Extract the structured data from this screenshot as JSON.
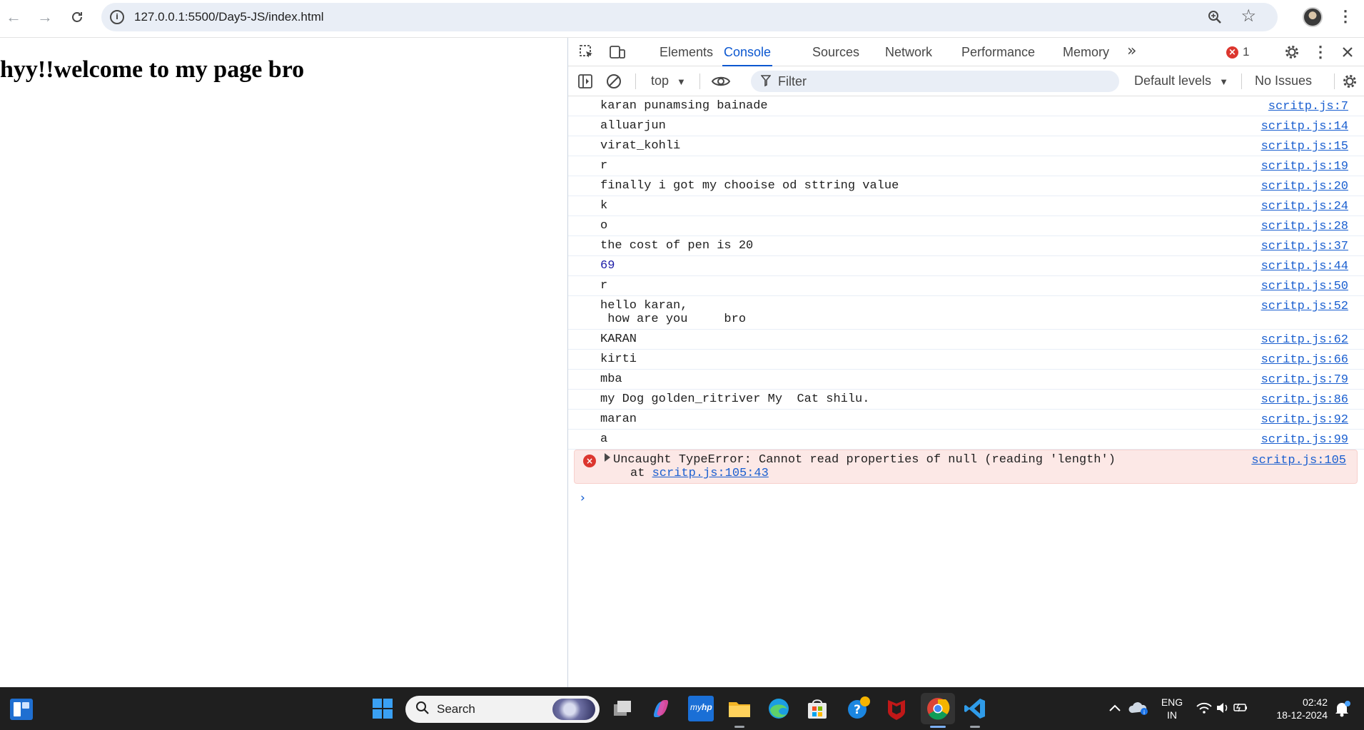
{
  "browser": {
    "url": "127.0.0.1:5500/Day5-JS/index.html"
  },
  "page": {
    "heading": "hyy!!welcome to my page bro"
  },
  "devtools": {
    "tabs": [
      "Elements",
      "Console",
      "Sources",
      "Network",
      "Performance",
      "Memory"
    ],
    "active_tab": "Console",
    "error_count": "1",
    "context": "top",
    "filter_placeholder": "Filter",
    "levels": "Default levels",
    "issues": "No Issues",
    "messages": [
      {
        "text": "karan punamsing bainade",
        "source": "scritp.js:7"
      },
      {
        "text": "alluarjun",
        "source": "scritp.js:14"
      },
      {
        "text": "virat_kohli",
        "source": "scritp.js:15"
      },
      {
        "text": "r",
        "source": "scritp.js:19"
      },
      {
        "text": "finally i got my chooise od sttring value",
        "source": "scritp.js:20"
      },
      {
        "text": "k",
        "source": "scritp.js:24"
      },
      {
        "text": "o",
        "source": "scritp.js:28"
      },
      {
        "text": "the cost of pen is 20",
        "source": "scritp.js:37"
      },
      {
        "text": "69",
        "source": "scritp.js:44",
        "type": "number"
      },
      {
        "text": "r",
        "source": "scritp.js:50"
      },
      {
        "text": "hello karan,\n how are you     bro",
        "source": "scritp.js:52"
      },
      {
        "text": "KARAN",
        "source": "scritp.js:62"
      },
      {
        "text": "kirti",
        "source": "scritp.js:66"
      },
      {
        "text": "mba",
        "source": "scritp.js:79"
      },
      {
        "text": "my Dog golden_ritriver My  Cat shilu.",
        "source": "scritp.js:86"
      },
      {
        "text": "maran",
        "source": "scritp.js:92"
      },
      {
        "text": "a",
        "source": "scritp.js:99"
      }
    ],
    "error": {
      "message": "Uncaught TypeError: Cannot read properties of null (reading 'length')",
      "at_prefix": "at",
      "at_link": "scritp.js:105:43",
      "source": "scritp.js:105"
    }
  },
  "taskbar": {
    "search_label": "Search",
    "lang_line1": "ENG",
    "lang_line2": "IN",
    "time": "02:42",
    "date": "18-12-2024"
  }
}
